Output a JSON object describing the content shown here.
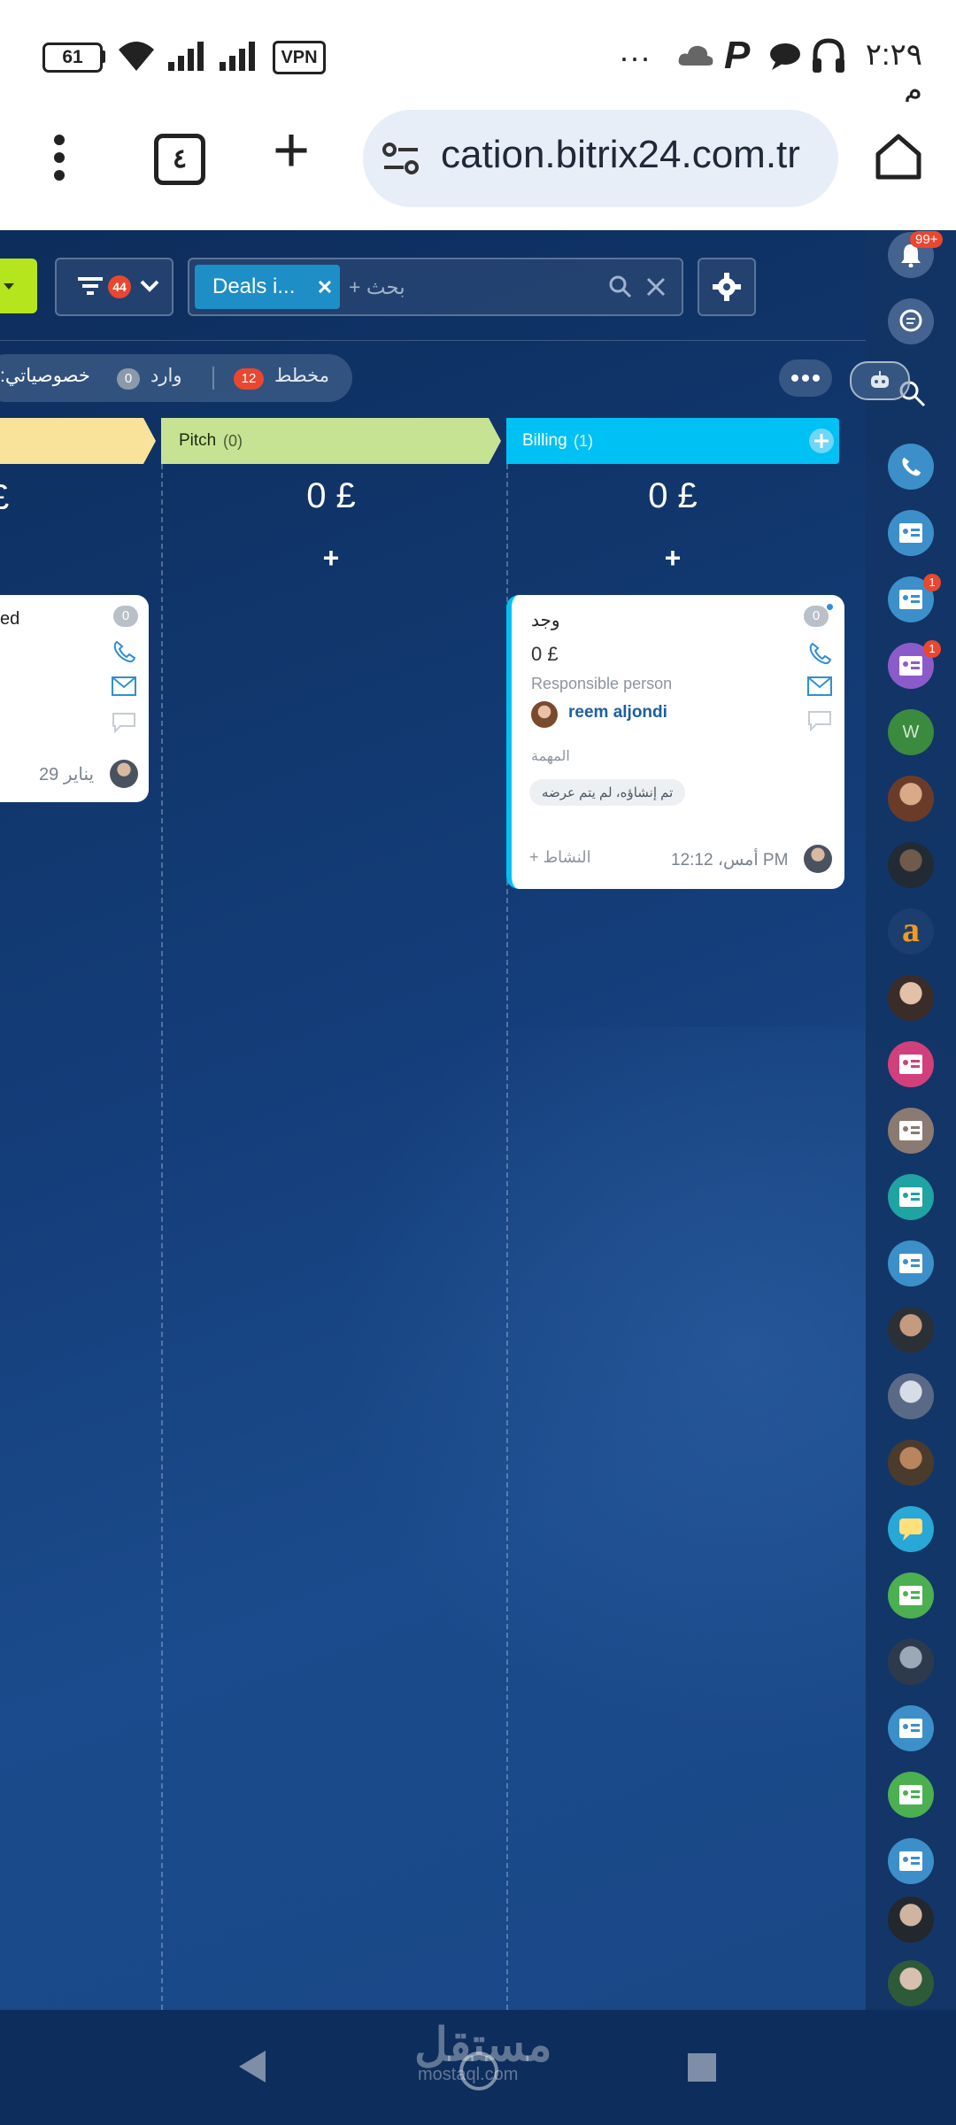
{
  "status_bar": {
    "time": "٢:٢٩ م",
    "battery": "61",
    "vpn": "VPN",
    "more": "..."
  },
  "browser": {
    "url": "cation.bitrix24.com.tr",
    "tabs_count": "٤",
    "new_tab": "+"
  },
  "toolbar": {
    "filter_count": "44",
    "chip_label": "Deals i...",
    "search_placeholder": "+ بحث"
  },
  "counters": {
    "planned_label": "مخطط",
    "planned_count": "12",
    "incoming_label": "وارد",
    "incoming_count": "0",
    "specifics_label": ":خصوصياتي"
  },
  "columns": [
    {
      "name": "Pitch",
      "count": "(0)",
      "total": "0 £",
      "add": "+"
    },
    {
      "name": "Billing",
      "count": "(1)",
      "total": "0 £",
      "add": "+"
    }
  ],
  "left_partial": {
    "total_fragment": "£",
    "title_fragment": "ed",
    "badge": "0",
    "date": "29 يناير"
  },
  "deal_card": {
    "title": "وجد",
    "amount": "0 £",
    "badge": "0",
    "responsible_label": "Responsible person",
    "responsible_name": "reem aljondi",
    "task_label": "المهمة",
    "task_chip": "تم إنشاؤه، لم يتم عرضه",
    "activity": "+ النشاط",
    "timestamp": "أمس، 12:12 PM"
  },
  "notifications": {
    "badge": "99+"
  },
  "sidebar_badges": [
    "1",
    "1"
  ],
  "sidebar_letter_w": "W",
  "sidebar_letter_a": "a",
  "watermark": {
    "arabic": "مستقل",
    "latin": "mostaql.com"
  },
  "colors": {
    "accent_lime": "#b5e61d",
    "pitch": "#c6e394",
    "billing": "#00c1f3",
    "left_stage": "#f9e39a",
    "badge_red": "#e9472f",
    "link_blue": "#1b5fa0"
  }
}
